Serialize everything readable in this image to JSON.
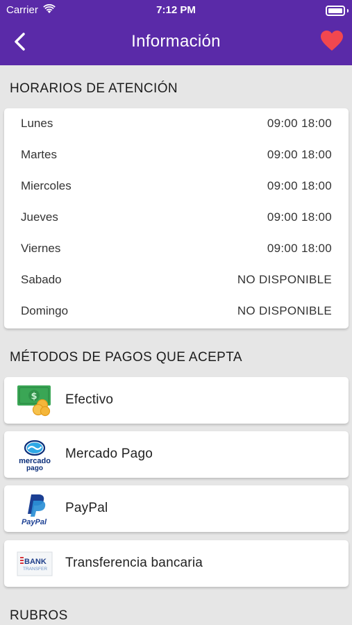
{
  "status_bar": {
    "carrier": "Carrier",
    "time": "7:12 PM"
  },
  "header": {
    "title": "Información",
    "back_icon": "chevron-left-icon",
    "favorite_icon": "heart-icon"
  },
  "hours_section": {
    "title": "HORARIOS DE ATENCIÓN",
    "rows": [
      {
        "day": "Lunes",
        "hours": "09:00 18:00"
      },
      {
        "day": "Martes",
        "hours": "09:00 18:00"
      },
      {
        "day": "Miercoles",
        "hours": "09:00 18:00"
      },
      {
        "day": "Jueves",
        "hours": "09:00 18:00"
      },
      {
        "day": "Viernes",
        "hours": "09:00 18:00"
      },
      {
        "day": "Sabado",
        "hours": "NO DISPONIBLE"
      },
      {
        "day": "Domingo",
        "hours": "NO DISPONIBLE"
      }
    ]
  },
  "payments_section": {
    "title": "MÉTODOS DE PAGOS QUE ACEPTA",
    "methods": [
      {
        "label": "Efectivo",
        "icon": "cash-icon"
      },
      {
        "label": "Mercado Pago",
        "icon": "mercado-pago-logo",
        "logo_text_1": "mercado",
        "logo_text_2": "pago"
      },
      {
        "label": "PayPal",
        "icon": "paypal-logo",
        "logo_text": "PayPal"
      },
      {
        "label": "Transferencia bancaria",
        "icon": "bank-transfer-logo",
        "logo_text_1": "BANK",
        "logo_text_2": "TRANSFER"
      }
    ]
  },
  "rubros_section": {
    "title": "RUBROS"
  },
  "colors": {
    "header_bg": "#5a2aa8",
    "heart": "#f2474f",
    "page_bg": "#e6e6e6"
  }
}
